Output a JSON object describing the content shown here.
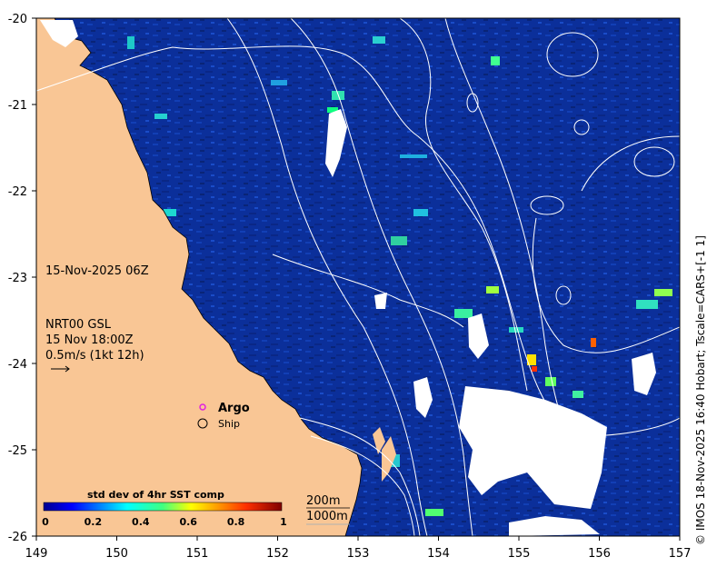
{
  "map": {
    "lon_ticks": [
      "149",
      "150",
      "151",
      "152",
      "153",
      "154",
      "155",
      "156",
      "157"
    ],
    "lat_ticks": [
      "-20",
      "-21",
      "-22",
      "-23",
      "-24",
      "-25",
      "-26"
    ],
    "lon_range": [
      149,
      157
    ],
    "lat_range": [
      -26,
      -20
    ],
    "colors": {
      "ocean": "#0b2f9a",
      "land": "#f9c695",
      "nodata": "#ffffff",
      "contour": "#ffffff"
    }
  },
  "annotations": {
    "date": "15-Nov-2025 06Z",
    "nrt_title": "NRT00 GSL",
    "nrt_time": "15 Nov 18:00Z",
    "vector_scale": "0.5m/s (1kt 12h)"
  },
  "legend": {
    "argo_label": "Argo",
    "ship_label": "Ship",
    "argo_color": "#e020e0"
  },
  "colorbar": {
    "title": "std dev of 4hr SST comp",
    "tick_labels": [
      "0",
      "0.2",
      "0.4",
      "0.6",
      "0.8",
      "1"
    ],
    "colormap": "jet"
  },
  "isobaths": [
    "200m",
    "1000m"
  ],
  "credit": "© IMOS 18-Nov-2025 16:40 Hobart; Tscale=CARS+[-1 1]"
}
